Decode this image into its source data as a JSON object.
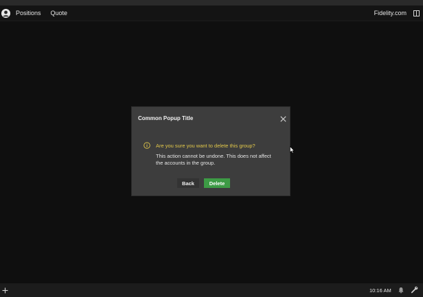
{
  "header": {
    "nav": [
      "Positions",
      "Quote"
    ],
    "brand_link": "Fidelity.com",
    "avatar_icon": "user-avatar-icon",
    "panel_icon": "panel-toggle-icon"
  },
  "modal": {
    "title": "Common Popup Title",
    "close_icon": "close-icon",
    "warning": "Are you sure you want to delete this group?",
    "warning_color": "#e2c84a",
    "body": "This action cannot be undone. This does not affect the accounts in the group.",
    "buttons": {
      "back": "Back",
      "delete": "Delete"
    },
    "delete_color": "#3d9b45"
  },
  "taskbar": {
    "add_icon": "plus-icon",
    "time": "10:16 AM",
    "bell_icon": "bell-icon",
    "settings_icon": "wrench-icon"
  }
}
